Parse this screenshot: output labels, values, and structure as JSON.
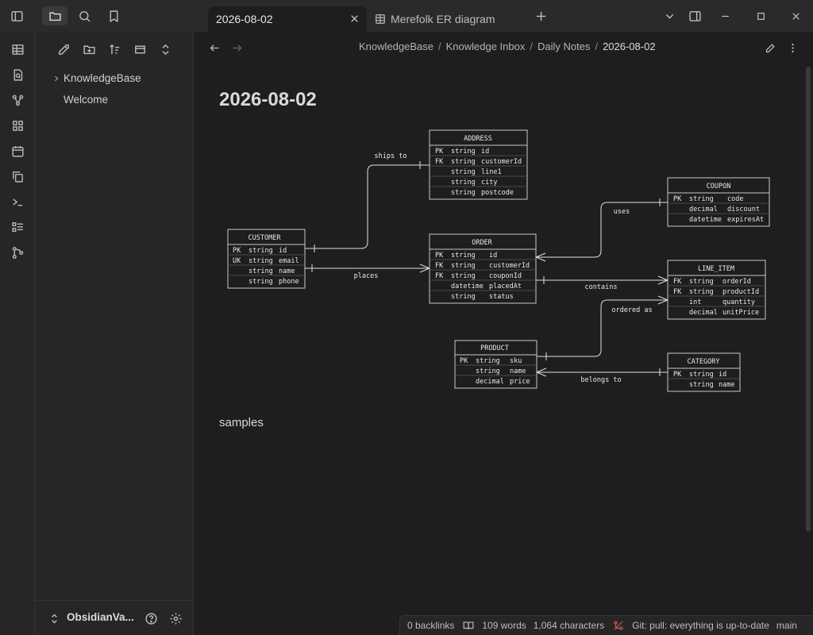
{
  "titlebar": {
    "icons": [
      "sidebar-toggle-icon",
      "folder-icon",
      "search-icon",
      "bookmark-icon"
    ],
    "tabs": [
      {
        "label": "2026-08-02",
        "active": true
      },
      {
        "label": "Merefolk ER diagram",
        "active": false
      }
    ],
    "new_tab_icon": "plus-icon"
  },
  "ribbon": {
    "icons": [
      "table-icon",
      "file-search-icon",
      "graph-icon",
      "blocks-icon",
      "calendar-icon",
      "copy-icon",
      "terminal-icon",
      "list-icon",
      "git-branch-icon"
    ]
  },
  "sidebar": {
    "tree": [
      {
        "label": "KnowledgeBase",
        "type": "folder"
      },
      {
        "label": "Welcome",
        "type": "file"
      }
    ],
    "vault_name": "ObsidianVa..."
  },
  "main": {
    "breadcrumb": [
      "KnowledgeBase",
      "Knowledge Inbox",
      "Daily Notes",
      "2026-08-02"
    ],
    "title": "2026-08-02",
    "body_text": "samples"
  },
  "diagram": {
    "entities": [
      {
        "name": "ADDRESS",
        "rows": [
          [
            "PK",
            "string",
            "id"
          ],
          [
            "FK",
            "string",
            "customerId"
          ],
          [
            "",
            "string",
            "line1"
          ],
          [
            "",
            "string",
            "city"
          ],
          [
            "",
            "string",
            "postcode"
          ]
        ]
      },
      {
        "name": "COUPON",
        "rows": [
          [
            "PK",
            "string",
            "code"
          ],
          [
            "",
            "decimal",
            "discount"
          ],
          [
            "",
            "datetime",
            "expiresAt"
          ]
        ]
      },
      {
        "name": "CUSTOMER",
        "rows": [
          [
            "PK",
            "string",
            "id"
          ],
          [
            "UK",
            "string",
            "email"
          ],
          [
            "",
            "string",
            "name"
          ],
          [
            "",
            "string",
            "phone"
          ]
        ]
      },
      {
        "name": "ORDER",
        "rows": [
          [
            "PK",
            "string",
            "id"
          ],
          [
            "FK",
            "string",
            "customerId"
          ],
          [
            "FK",
            "string",
            "couponId"
          ],
          [
            "",
            "datetime",
            "placedAt"
          ],
          [
            "",
            "string",
            "status"
          ]
        ]
      },
      {
        "name": "LINE_ITEM",
        "rows": [
          [
            "FK",
            "string",
            "orderId"
          ],
          [
            "FK",
            "string",
            "productId"
          ],
          [
            "",
            "int",
            "quantity"
          ],
          [
            "",
            "decimal",
            "unitPrice"
          ]
        ]
      },
      {
        "name": "PRODUCT",
        "rows": [
          [
            "PK",
            "string",
            "sku"
          ],
          [
            "",
            "string",
            "name"
          ],
          [
            "",
            "decimal",
            "price"
          ]
        ]
      },
      {
        "name": "CATEGORY",
        "rows": [
          [
            "PK",
            "string",
            "id"
          ],
          [
            "",
            "string",
            "name"
          ]
        ]
      }
    ],
    "relations": [
      "ships to",
      "uses",
      "places",
      "contains",
      "ordered as",
      "belongs to"
    ]
  },
  "status": {
    "backlinks": "0 backlinks",
    "words": "109 words",
    "characters": "1,064 characters",
    "git": "Git: pull: everything is up-to-date",
    "branch": "main"
  }
}
